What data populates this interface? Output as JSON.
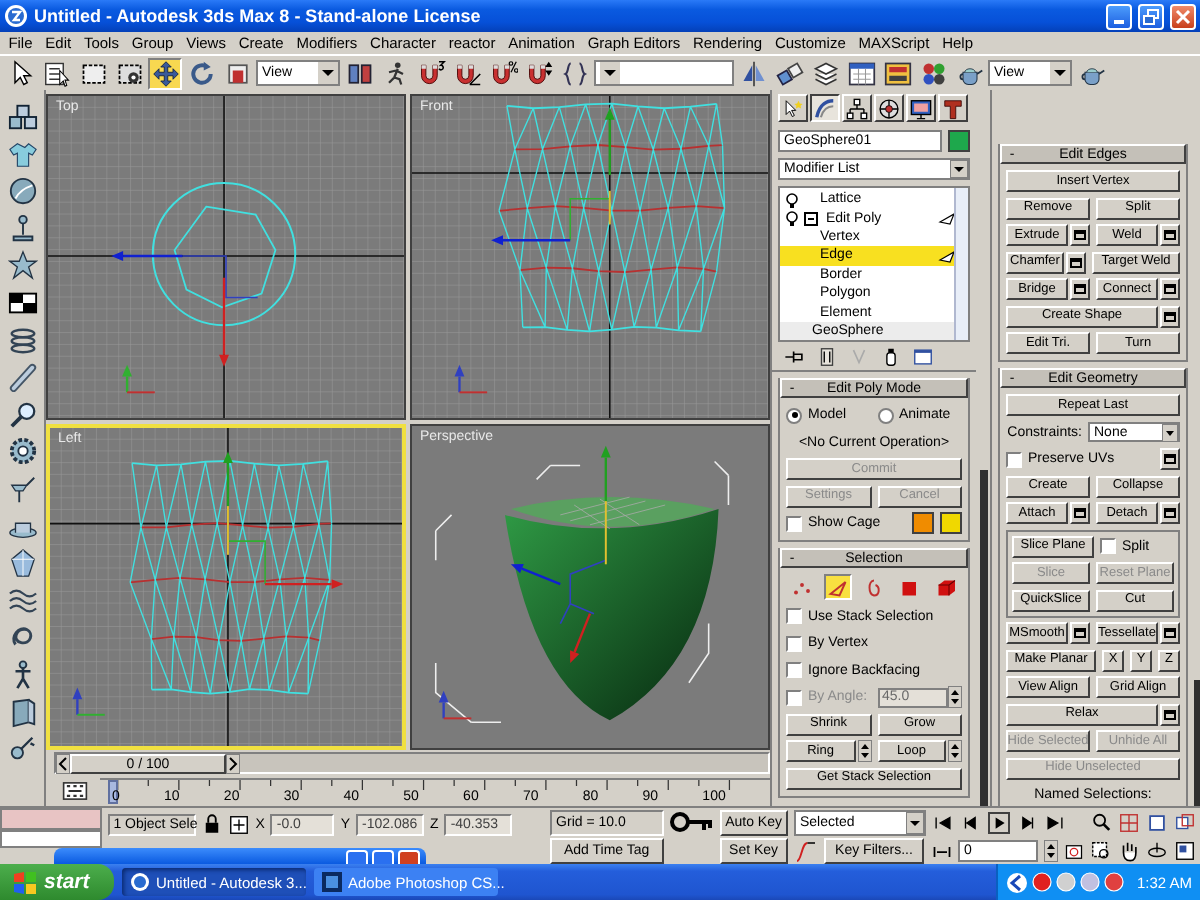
{
  "window": {
    "title": "Untitled - Autodesk 3ds Max 8  - Stand-alone License"
  },
  "menu": [
    "File",
    "Edit",
    "Tools",
    "Group",
    "Views",
    "Create",
    "Modifiers",
    "Character",
    "reactor",
    "Animation",
    "Graph Editors",
    "Rendering",
    "Customize",
    "MAXScript",
    "Help"
  ],
  "toolbar": [
    {
      "kind": "pointer",
      "selected": false
    },
    {
      "kind": "namelist",
      "selected": false
    },
    {
      "kind": "rect",
      "selected": false
    },
    {
      "kind": "crossing",
      "selected": false
    },
    {
      "kind": "move",
      "selected": true
    },
    {
      "kind": "rotate",
      "selected": false
    },
    {
      "kind": "scale",
      "selected": false
    },
    {
      "kind": "dropdown",
      "value": "View"
    },
    {
      "kind": "pivot",
      "selected": false
    },
    {
      "kind": "figure",
      "selected": false
    },
    {
      "kind": "snap",
      "selected": false
    },
    {
      "kind": "angle",
      "selected": false
    },
    {
      "kind": "percent",
      "selected": false
    },
    {
      "kind": "spinner",
      "selected": false
    },
    {
      "kind": "braces",
      "selected": false
    },
    {
      "kind": "namedset"
    },
    {
      "kind": "mirror",
      "selected": false
    },
    {
      "kind": "align",
      "selected": false
    },
    {
      "kind": "layers",
      "selected": false
    },
    {
      "kind": "curve",
      "selected": false
    },
    {
      "kind": "schematic",
      "selected": false
    },
    {
      "kind": "material",
      "selected": false
    },
    {
      "kind": "render",
      "selected": false
    },
    {
      "kind": "dropdown",
      "value": "View"
    },
    {
      "kind": "teapot",
      "selected": false
    }
  ],
  "viewports": [
    {
      "label": "Top",
      "kind": "top",
      "selected": false
    },
    {
      "label": "Front",
      "kind": "front",
      "selected": false
    },
    {
      "label": "Left",
      "kind": "left",
      "selected": true
    },
    {
      "label": "Perspective",
      "kind": "perspective",
      "selected": false
    }
  ],
  "time_slider": {
    "position": "0 / 100"
  },
  "track_bar": {
    "ticks": [
      "0",
      "10",
      "20",
      "30",
      "40",
      "50",
      "60",
      "70",
      "80",
      "90",
      "100"
    ]
  },
  "command_panel": {
    "tabs": [
      {
        "kind": "create",
        "selected": false
      },
      {
        "kind": "modify",
        "selected": true
      },
      {
        "kind": "hierarchy",
        "selected": false
      },
      {
        "kind": "motion",
        "selected": false
      },
      {
        "kind": "display",
        "selected": false
      },
      {
        "kind": "utilities",
        "selected": false
      }
    ],
    "object_name": "GeoSphere01",
    "modifier_list": "Modifier List",
    "stack": [
      {
        "label": "Lattice",
        "selected": false
      },
      {
        "label": "Edit Poly",
        "selected": false,
        "expanded": true,
        "children": [
          {
            "label": "Vertex",
            "selected": false
          },
          {
            "label": "Edge",
            "selected": true
          },
          {
            "label": "Border",
            "selected": false
          },
          {
            "label": "Polygon",
            "selected": false
          },
          {
            "label": "Element",
            "selected": false
          }
        ]
      },
      {
        "label": "GeoSphere",
        "selected": false
      }
    ],
    "left_rollouts": [
      {
        "toggle": "-",
        "title": "Edit Poly Mode",
        "rows": [
          [
            {
              "kind": "radio",
              "label": "Model",
              "selected": true
            },
            {
              "kind": "radio",
              "label": "Animate",
              "selected": false
            }
          ],
          [
            {
              "kind": "text",
              "label": "<No Current Operation>"
            }
          ],
          [
            {
              "kind": "button",
              "label": "Commit",
              "disabled": true
            }
          ],
          [
            {
              "kind": "button",
              "label": "Settings",
              "disabled": true
            },
            {
              "kind": "button",
              "label": "Cancel",
              "disabled": true
            }
          ],
          [
            {
              "kind": "checkbox",
              "label": "Show Cage",
              "checked": false,
              "disabled": false
            },
            {
              "kind": "swatch",
              "color": "#f08c00"
            },
            {
              "kind": "swatch",
              "color": "#f0d800"
            }
          ]
        ]
      },
      {
        "toggle": "-",
        "title": "Selection",
        "rows": [
          [
            {
              "kind": "levels",
              "items": [
                {
                  "kind": "vertex",
                  "selected": false
                },
                {
                  "kind": "edge",
                  "selected": true
                },
                {
                  "kind": "border",
                  "selected": false
                },
                {
                  "kind": "polygon",
                  "selected": false
                },
                {
                  "kind": "element",
                  "selected": false
                }
              ]
            }
          ],
          [
            {
              "kind": "checkbox",
              "label": "Use Stack Selection",
              "checked": false,
              "disabled": false
            }
          ],
          [
            {
              "kind": "checkbox",
              "label": "By Vertex",
              "checked": false,
              "disabled": false
            }
          ],
          [
            {
              "kind": "checkbox",
              "label": "Ignore Backfacing",
              "checked": false,
              "disabled": false
            }
          ],
          [
            {
              "kind": "checkbox",
              "label": "By Angle:",
              "checked": false,
              "disabled": true
            },
            {
              "kind": "spinner",
              "value": "45.0",
              "disabled": true
            }
          ],
          [
            {
              "kind": "button",
              "label": "Shrink",
              "disabled": false
            },
            {
              "kind": "button",
              "label": "Grow",
              "disabled": false
            }
          ],
          [
            {
              "kind": "spinbutton",
              "label": "Ring",
              "disabled": false
            },
            {
              "kind": "spinbutton",
              "label": "Loop",
              "disabled": false
            }
          ],
          [
            {
              "kind": "button",
              "label": "Get Stack Selection",
              "disabled": false
            }
          ]
        ]
      }
    ],
    "right_rollouts": [
      {
        "toggle": "-",
        "title": "Edit Edges",
        "rows": [
          [
            {
              "kind": "button",
              "label": "Insert Vertex",
              "disabled": false
            }
          ],
          [
            {
              "kind": "button",
              "label": "Remove",
              "disabled": false
            },
            {
              "kind": "button",
              "label": "Split",
              "disabled": false
            }
          ],
          [
            {
              "kind": "setbutton",
              "label": "Extrude",
              "disabled": false
            },
            {
              "kind": "setbutton",
              "label": "Weld",
              "disabled": false
            }
          ],
          [
            {
              "kind": "setbutton",
              "label": "Chamfer",
              "disabled": false
            },
            {
              "kind": "button",
              "label": "Target Weld",
              "disabled": false
            }
          ],
          [
            {
              "kind": "setbutton",
              "label": "Bridge",
              "disabled": false
            },
            {
              "kind": "setbutton",
              "label": "Connect",
              "disabled": false
            }
          ],
          [
            {
              "kind": "setbutton",
              "label": "Create Shape",
              "disabled": false
            }
          ],
          [
            {
              "kind": "button",
              "label": "Edit Tri.",
              "disabled": false
            },
            {
              "kind": "button",
              "label": "Turn",
              "disabled": false
            }
          ]
        ]
      },
      {
        "toggle": "-",
        "title": "Edit Geometry",
        "rows": [
          [
            {
              "kind": "button",
              "label": "Repeat Last",
              "disabled": false
            }
          ],
          [
            {
              "kind": "text",
              "label": "Constraints:"
            },
            {
              "kind": "dropdown",
              "value": "None"
            }
          ],
          [
            {
              "kind": "setcheckbox",
              "label": "Preserve UVs",
              "checked": false,
              "disabled": false
            }
          ],
          [
            {
              "kind": "button",
              "label": "Create",
              "disabled": false
            },
            {
              "kind": "button",
              "label": "Collapse",
              "disabled": false
            }
          ],
          [
            {
              "kind": "setbutton",
              "label": "Attach",
              "disabled": false
            },
            {
              "kind": "setbutton",
              "label": "Detach",
              "disabled": false
            }
          ],
          [
            {
              "kind": "group",
              "rows": [
                [
                  {
                    "kind": "button",
                    "label": "Slice Plane",
                    "disabled": false
                  },
                  {
                    "kind": "checkbox",
                    "label": "Split",
                    "checked": false,
                    "disabled": false
                  }
                ],
                [
                  {
                    "kind": "button",
                    "label": "Slice",
                    "disabled": true
                  },
                  {
                    "kind": "button",
                    "label": "Reset Plane",
                    "disabled": true
                  }
                ],
                [
                  {
                    "kind": "button",
                    "label": "QuickSlice",
                    "disabled": false
                  },
                  {
                    "kind": "button",
                    "label": "Cut",
                    "disabled": false
                  }
                ]
              ]
            }
          ],
          [
            {
              "kind": "setbutton",
              "label": "MSmooth",
              "disabled": false
            },
            {
              "kind": "setbutton",
              "label": "Tessellate",
              "disabled": false
            }
          ],
          [
            {
              "kind": "button",
              "label": "Make Planar",
              "disabled": false
            },
            {
              "kind": "mini",
              "label": "X",
              "disabled": false
            },
            {
              "kind": "mini",
              "label": "Y",
              "disabled": false
            },
            {
              "kind": "mini",
              "label": "Z",
              "disabled": false
            }
          ],
          [
            {
              "kind": "button",
              "label": "View Align",
              "disabled": false
            },
            {
              "kind": "button",
              "label": "Grid Align",
              "disabled": false
            }
          ],
          [
            {
              "kind": "setbutton",
              "label": "Relax",
              "disabled": false
            }
          ],
          [
            {
              "kind": "button",
              "label": "Hide Selected",
              "disabled": true
            },
            {
              "kind": "button",
              "label": "Unhide All",
              "disabled": true
            }
          ],
          [
            {
              "kind": "button",
              "label": "Hide Unselected",
              "disabled": true
            }
          ],
          [
            {
              "kind": "text",
              "label": "Named Selections:"
            }
          ]
        ]
      }
    ]
  },
  "status_bar": {
    "selection": "1 Object Sele",
    "coords": [
      {
        "axis": "X",
        "value": "-0.0"
      },
      {
        "axis": "Y",
        "value": "-102.086"
      },
      {
        "axis": "Z",
        "value": "-40.353"
      }
    ],
    "grid": "Grid = 10.0",
    "time_tag": "Add Time Tag",
    "auto_key": "Auto Key",
    "set_key": "Set Key",
    "key_mode": "Selected",
    "key_filters": "Key Filters...",
    "frame": "0"
  },
  "taskbar": {
    "start": "start",
    "tasks": [
      {
        "label": "Untitled - Autodesk 3...",
        "selected": true
      },
      {
        "label": "Adobe Photoshop CS...",
        "selected": false
      }
    ],
    "clock": "1:32 AM"
  }
}
